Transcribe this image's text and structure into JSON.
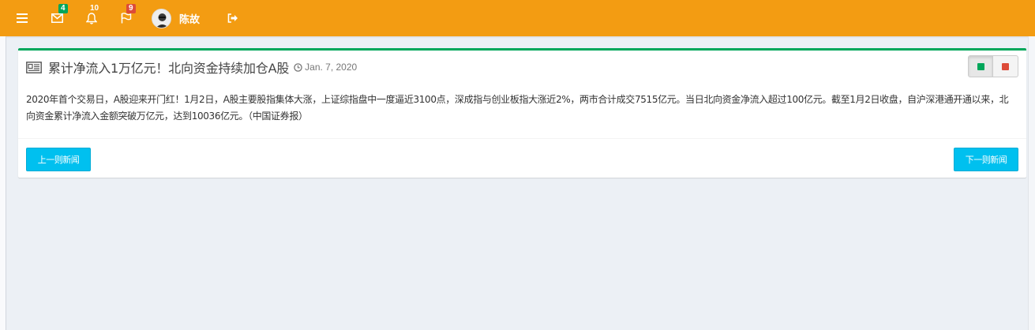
{
  "topbar": {
    "menu_icon": "hamburger-icon",
    "mail": {
      "icon": "envelope-icon",
      "badge": "4"
    },
    "notifications": {
      "icon": "bell-icon",
      "badge": "10"
    },
    "tasks": {
      "icon": "flag-icon",
      "badge": "9"
    },
    "user": {
      "avatar": "user-avatar",
      "name": "陈故"
    },
    "signout_icon": "sign-out-icon",
    "colors": {
      "bar": "#f39c12",
      "badge_green": "#00a65a",
      "badge_red": "#dd4b39"
    }
  },
  "news": {
    "icon": "newspaper-icon",
    "title": "累计净流入1万亿元！北向资金持续加仓A股",
    "date": "Jan. 7, 2020",
    "date_icon": "clock-icon",
    "tools": {
      "left_color": "#00a65a",
      "right_color": "#dd4b39"
    },
    "body": "2020年首个交易日，A股迎来开门红！1月2日，A股主要股指集体大涨，上证综指盘中一度逼近3100点，深成指与创业板指大涨近2%，两市合计成交7515亿元。当日北向资金净流入超过100亿元。截至1月2日收盘，自沪深港通开通以来，北向资金累计净流入金额突破万亿元，达到10036亿元。（中国证券报）",
    "prev_label": "上一则新闻",
    "next_label": "下一则新闻",
    "accent": "#00a65a",
    "button_color": "#00c0ef"
  }
}
